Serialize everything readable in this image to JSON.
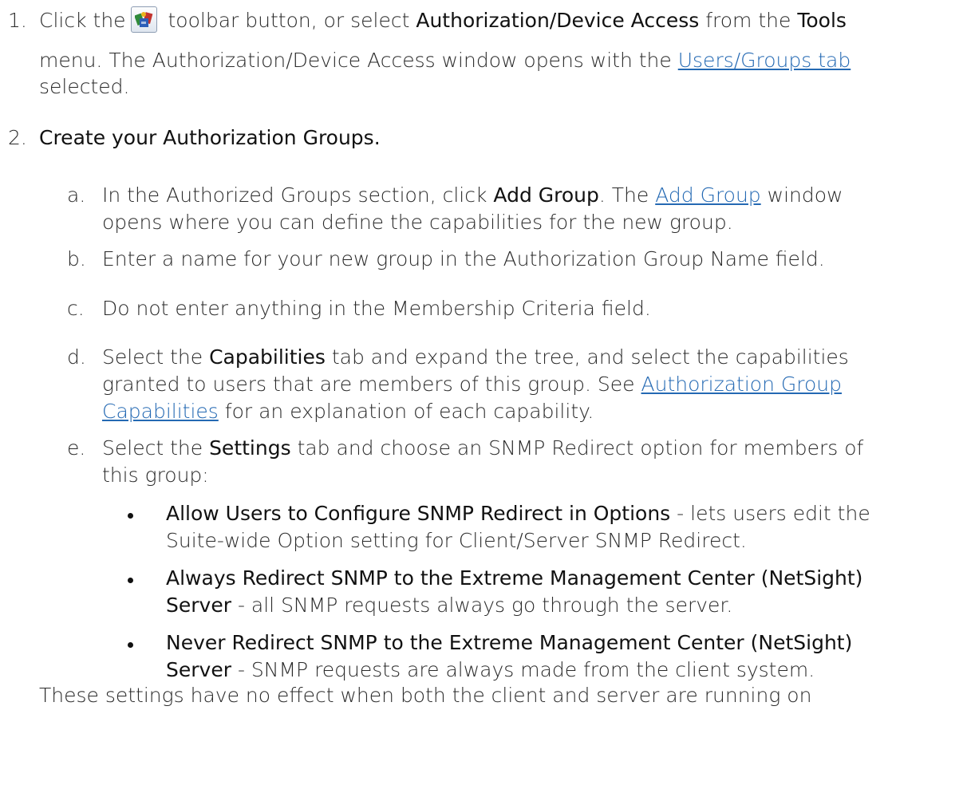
{
  "steps": [
    {
      "number": "1.",
      "line1_a": "Click the",
      "line1_b": "toolbar button, or select",
      "line1_c": "Authorization/Device Access",
      "line1_d": "from the",
      "line1_e": "Tools",
      "line2_a": "menu. The Authorization/Device Access window opens with the",
      "line2_link": "Users/Groups tab",
      "line3": "selected."
    },
    {
      "number": "2.",
      "title": "Create your Authorization Groups."
    }
  ],
  "toolbar_icon": "authorization-device-access-icon",
  "substeps": {
    "a": {
      "letter": "a.",
      "l1_a": "In the Authorized Groups section, click",
      "l1_b": "Add Group",
      "l1_c": ". The",
      "l1_link": "Add Group",
      "l1_d": "window",
      "l2": "opens where you can define the capabilities for the new group."
    },
    "b": {
      "letter": "b.",
      "text": "Enter a name for your new group in the Authorization Group Name field."
    },
    "c": {
      "letter": "c.",
      "text": "Do not enter anything in the Membership Criteria field."
    },
    "d": {
      "letter": "d.",
      "l1_a": "Select the",
      "l1_b": "Capabilities",
      "l1_c": "tab and expand the tree, and select the capabilities",
      "l2_a": "granted to users that are members of this group. See",
      "l2_link": "Authorization Group",
      "l3_link": "Capabilities",
      "l3_b": "for an explanation of each capability."
    },
    "e": {
      "letter": "e.",
      "l1_a": "Select the",
      "l1_b": "Settings",
      "l1_c": "tab and choose an SNMP Redirect option for members of",
      "l2": "this group:"
    }
  },
  "bullets": [
    {
      "l1_bold": "Allow Users to Configure SNMP Redirect in Options",
      "l1_rest": "- lets users edit the",
      "l2": "Suite-wide Option setting for Client/Server SNMP Redirect."
    },
    {
      "l1_bold": "Always Redirect SNMP to the Extreme Management Center (NetSight)",
      "l2_bold": "Server",
      "l2_rest": "- all SNMP requests always go through the server."
    },
    {
      "l1_bold": "Never Redirect SNMP to the Extreme Management Center (NetSight)",
      "l2_bold": "Server",
      "l2_rest": "- SNMP requests are always made from the client system."
    }
  ],
  "footer_text": "These settings have no effect when both the client and server are running on"
}
